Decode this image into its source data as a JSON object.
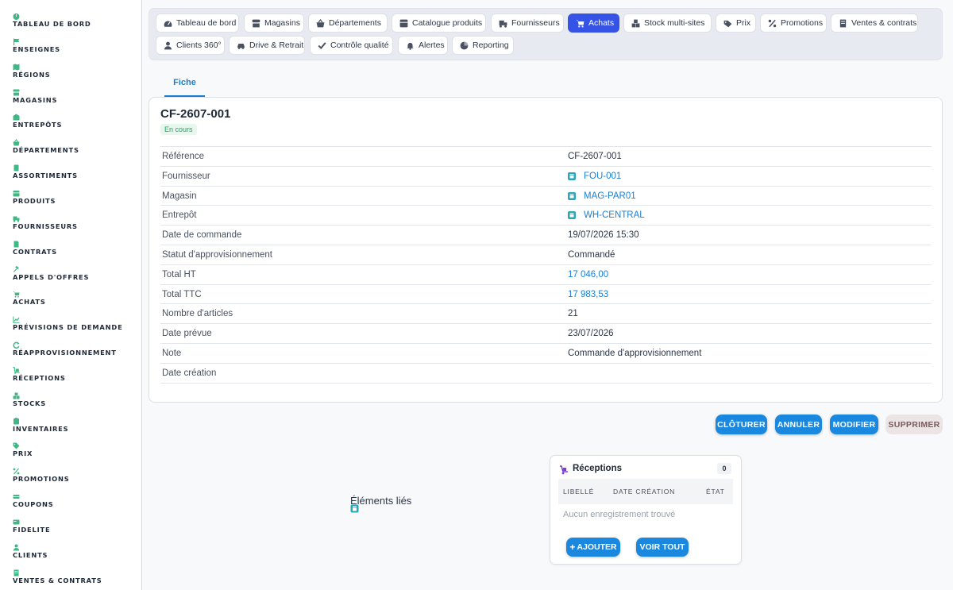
{
  "sidebar": {
    "items": [
      {
        "label": "TABLEAU DE BORD",
        "icon": "dashboard-icon"
      },
      {
        "label": "ENSEIGNES",
        "icon": "flag-icon"
      },
      {
        "label": "RÉGIONS",
        "icon": "map-icon"
      },
      {
        "label": "MAGASINS",
        "icon": "store-icon"
      },
      {
        "label": "ENTREPÔTS",
        "icon": "warehouse-icon"
      },
      {
        "label": "DÉPARTEMENTS",
        "icon": "basket-icon"
      },
      {
        "label": "ASSORTIMENTS",
        "icon": "list-icon"
      },
      {
        "label": "PRODUITS",
        "icon": "box-icon"
      },
      {
        "label": "FOURNISSEURS",
        "icon": "truck-icon"
      },
      {
        "label": "CONTRATS",
        "icon": "document-icon"
      },
      {
        "label": "APPELS D'OFFRES",
        "icon": "gavel-icon"
      },
      {
        "label": "ACHATS",
        "icon": "cart-icon"
      },
      {
        "label": "PRÉVISIONS DE DEMANDE",
        "icon": "chart-icon"
      },
      {
        "label": "RÉAPPROVISIONNEMENT",
        "icon": "refresh-icon"
      },
      {
        "label": "RÉCEPTIONS",
        "icon": "dolly-icon"
      },
      {
        "label": "STOCKS",
        "icon": "boxes-icon"
      },
      {
        "label": "INVENTAIRES",
        "icon": "clipboard-icon"
      },
      {
        "label": "PRIX",
        "icon": "tag-icon"
      },
      {
        "label": "PROMOTIONS",
        "icon": "percent-icon"
      },
      {
        "label": "COUPONS",
        "icon": "ticket-icon"
      },
      {
        "label": "FIDELITE",
        "icon": "card-icon"
      },
      {
        "label": "CLIENTS",
        "icon": "user-icon"
      },
      {
        "label": "VENTES & CONTRATS",
        "icon": "receipt-icon"
      }
    ]
  },
  "tabs": {
    "row1": [
      {
        "label": "Tableau de bord",
        "icon": "gauge-icon"
      },
      {
        "label": "Magasins",
        "icon": "store-icon"
      },
      {
        "label": "Départements",
        "icon": "basket-icon"
      },
      {
        "label": "Catalogue produits",
        "icon": "grid-icon"
      },
      {
        "label": "Fournisseurs",
        "icon": "truck-icon"
      },
      {
        "label": "Achats",
        "icon": "cart-icon",
        "active": true
      },
      {
        "label": "Stock multi-sites",
        "icon": "boxes-icon"
      },
      {
        "label": "Prix",
        "icon": "tags-icon"
      },
      {
        "label": "Promotions",
        "icon": "percent-icon"
      },
      {
        "label": "Ventes & contrats",
        "icon": "receipt-icon"
      }
    ],
    "row2": [
      {
        "label": "Clients 360°",
        "icon": "user-icon"
      },
      {
        "label": "Drive & Retrait",
        "icon": "car-icon"
      },
      {
        "label": "Contrôle qualité",
        "icon": "check-icon"
      },
      {
        "label": "Alertes",
        "icon": "bell-icon"
      },
      {
        "label": "Reporting",
        "icon": "pie-icon"
      }
    ]
  },
  "subtab": {
    "label": "Fiche"
  },
  "record": {
    "title": "CF-2607-001",
    "status": "En cours",
    "fields": [
      {
        "label": "Référence",
        "value": "CF-2607-001"
      },
      {
        "label": "Fournisseur",
        "value": "FOU-001",
        "link": true
      },
      {
        "label": "Magasin",
        "value": "MAG-PAR01",
        "link": true
      },
      {
        "label": "Entrepôt",
        "value": "WH-CENTRAL",
        "link": true
      },
      {
        "label": "Date de commande",
        "value": "19/07/2026 15:30"
      },
      {
        "label": "Statut d'approvisionnement",
        "value": "Commandé"
      },
      {
        "label": "Total HT",
        "value": "17 046,00",
        "accent": true
      },
      {
        "label": "Total TTC",
        "value": "17 983,53",
        "accent": true
      },
      {
        "label": "Nombre d'articles",
        "value": "21"
      },
      {
        "label": "Date prévue",
        "value": "23/07/2026"
      },
      {
        "label": "Note",
        "value": "Commande d'approvisionnement"
      },
      {
        "label": "Date création",
        "value": ""
      }
    ]
  },
  "actions": {
    "close": "CLÔTURER",
    "cancel": "ANNULER",
    "edit": "MODIFIER",
    "delete": "SUPPRIMER"
  },
  "linked": {
    "title": "Éléments liés"
  },
  "receptions": {
    "title": "Réceptions",
    "count": "0",
    "columns": [
      "LIBELLÉ",
      "DATE CRÉATION",
      "ÉTAT"
    ],
    "empty": "Aucun enregistrement trouvé",
    "add_label": "AJOUTER",
    "view_all_label": "VOIR TOUT"
  },
  "colors": {
    "accent": "#3553e6",
    "link": "#1a7fd2",
    "button": "#1a88de",
    "sidebar_icon": "#3fb886",
    "status_bg": "#e6f7ee",
    "status_text": "#2f9e64"
  }
}
